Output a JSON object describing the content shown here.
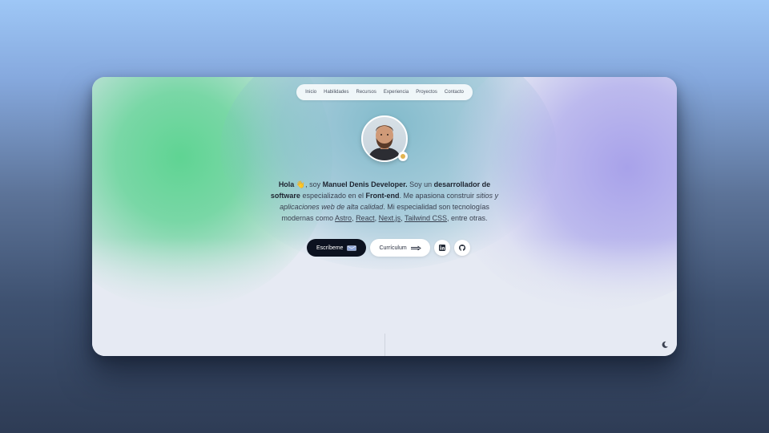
{
  "nav": {
    "items": [
      "Inicio",
      "Habilidades",
      "Recursos",
      "Experiencia",
      "Proyectos",
      "Contacto"
    ]
  },
  "hero": {
    "greeting": "Hola",
    "wave_emoji": "👋",
    "intro_1": ", soy ",
    "name": "Manuel Denis Developer.",
    "intro_2": " Soy un ",
    "role": "desarrollador de software",
    "intro_3": " especializado en el ",
    "focus": "Front-end",
    "intro_4": ". Me apasiona construir ",
    "passion": "sitios y aplicaciones web de alta calidad",
    "intro_5": ". Mi especialidad son tecnologías modernas como ",
    "tech": [
      "Astro",
      "React",
      "Next.js",
      "Tailwind CSS"
    ],
    "sep": ", ",
    "outro": ", entre otras."
  },
  "buttons": {
    "contact_label": "Escríbeme",
    "cv_label": "Currículum"
  },
  "icons": {
    "linkedin": "linkedin-icon",
    "github": "github-icon",
    "theme": "moon-icon",
    "mail": "mail-icon",
    "arrow": "arrow-right-icon"
  },
  "colors": {
    "dark_button": "#0c1220",
    "accent_green": "#5fd493",
    "accent_purple": "#a8a2ea"
  }
}
